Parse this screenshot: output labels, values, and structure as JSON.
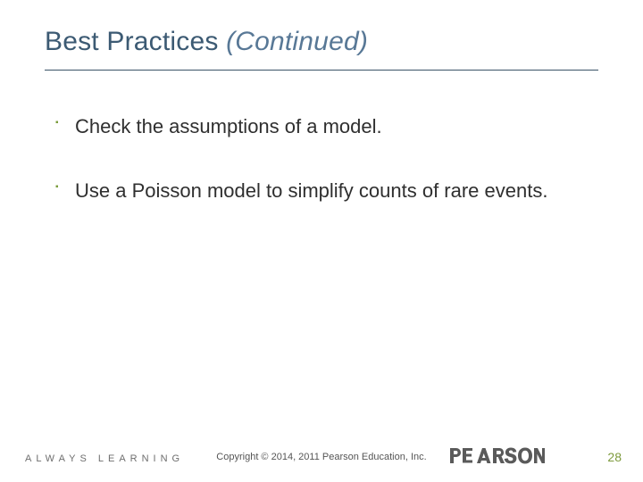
{
  "title": {
    "main": "Best Practices ",
    "suffix": "(Continued)"
  },
  "bullets": [
    "Check the assumptions of a model.",
    "Use a Poisson model to simplify counts of rare events."
  ],
  "footer": {
    "tagline": "ALWAYS LEARNING",
    "copyright": "Copyright © 2014, 2011 Pearson Education, Inc.",
    "brand": "PEARSON",
    "page": "28"
  }
}
